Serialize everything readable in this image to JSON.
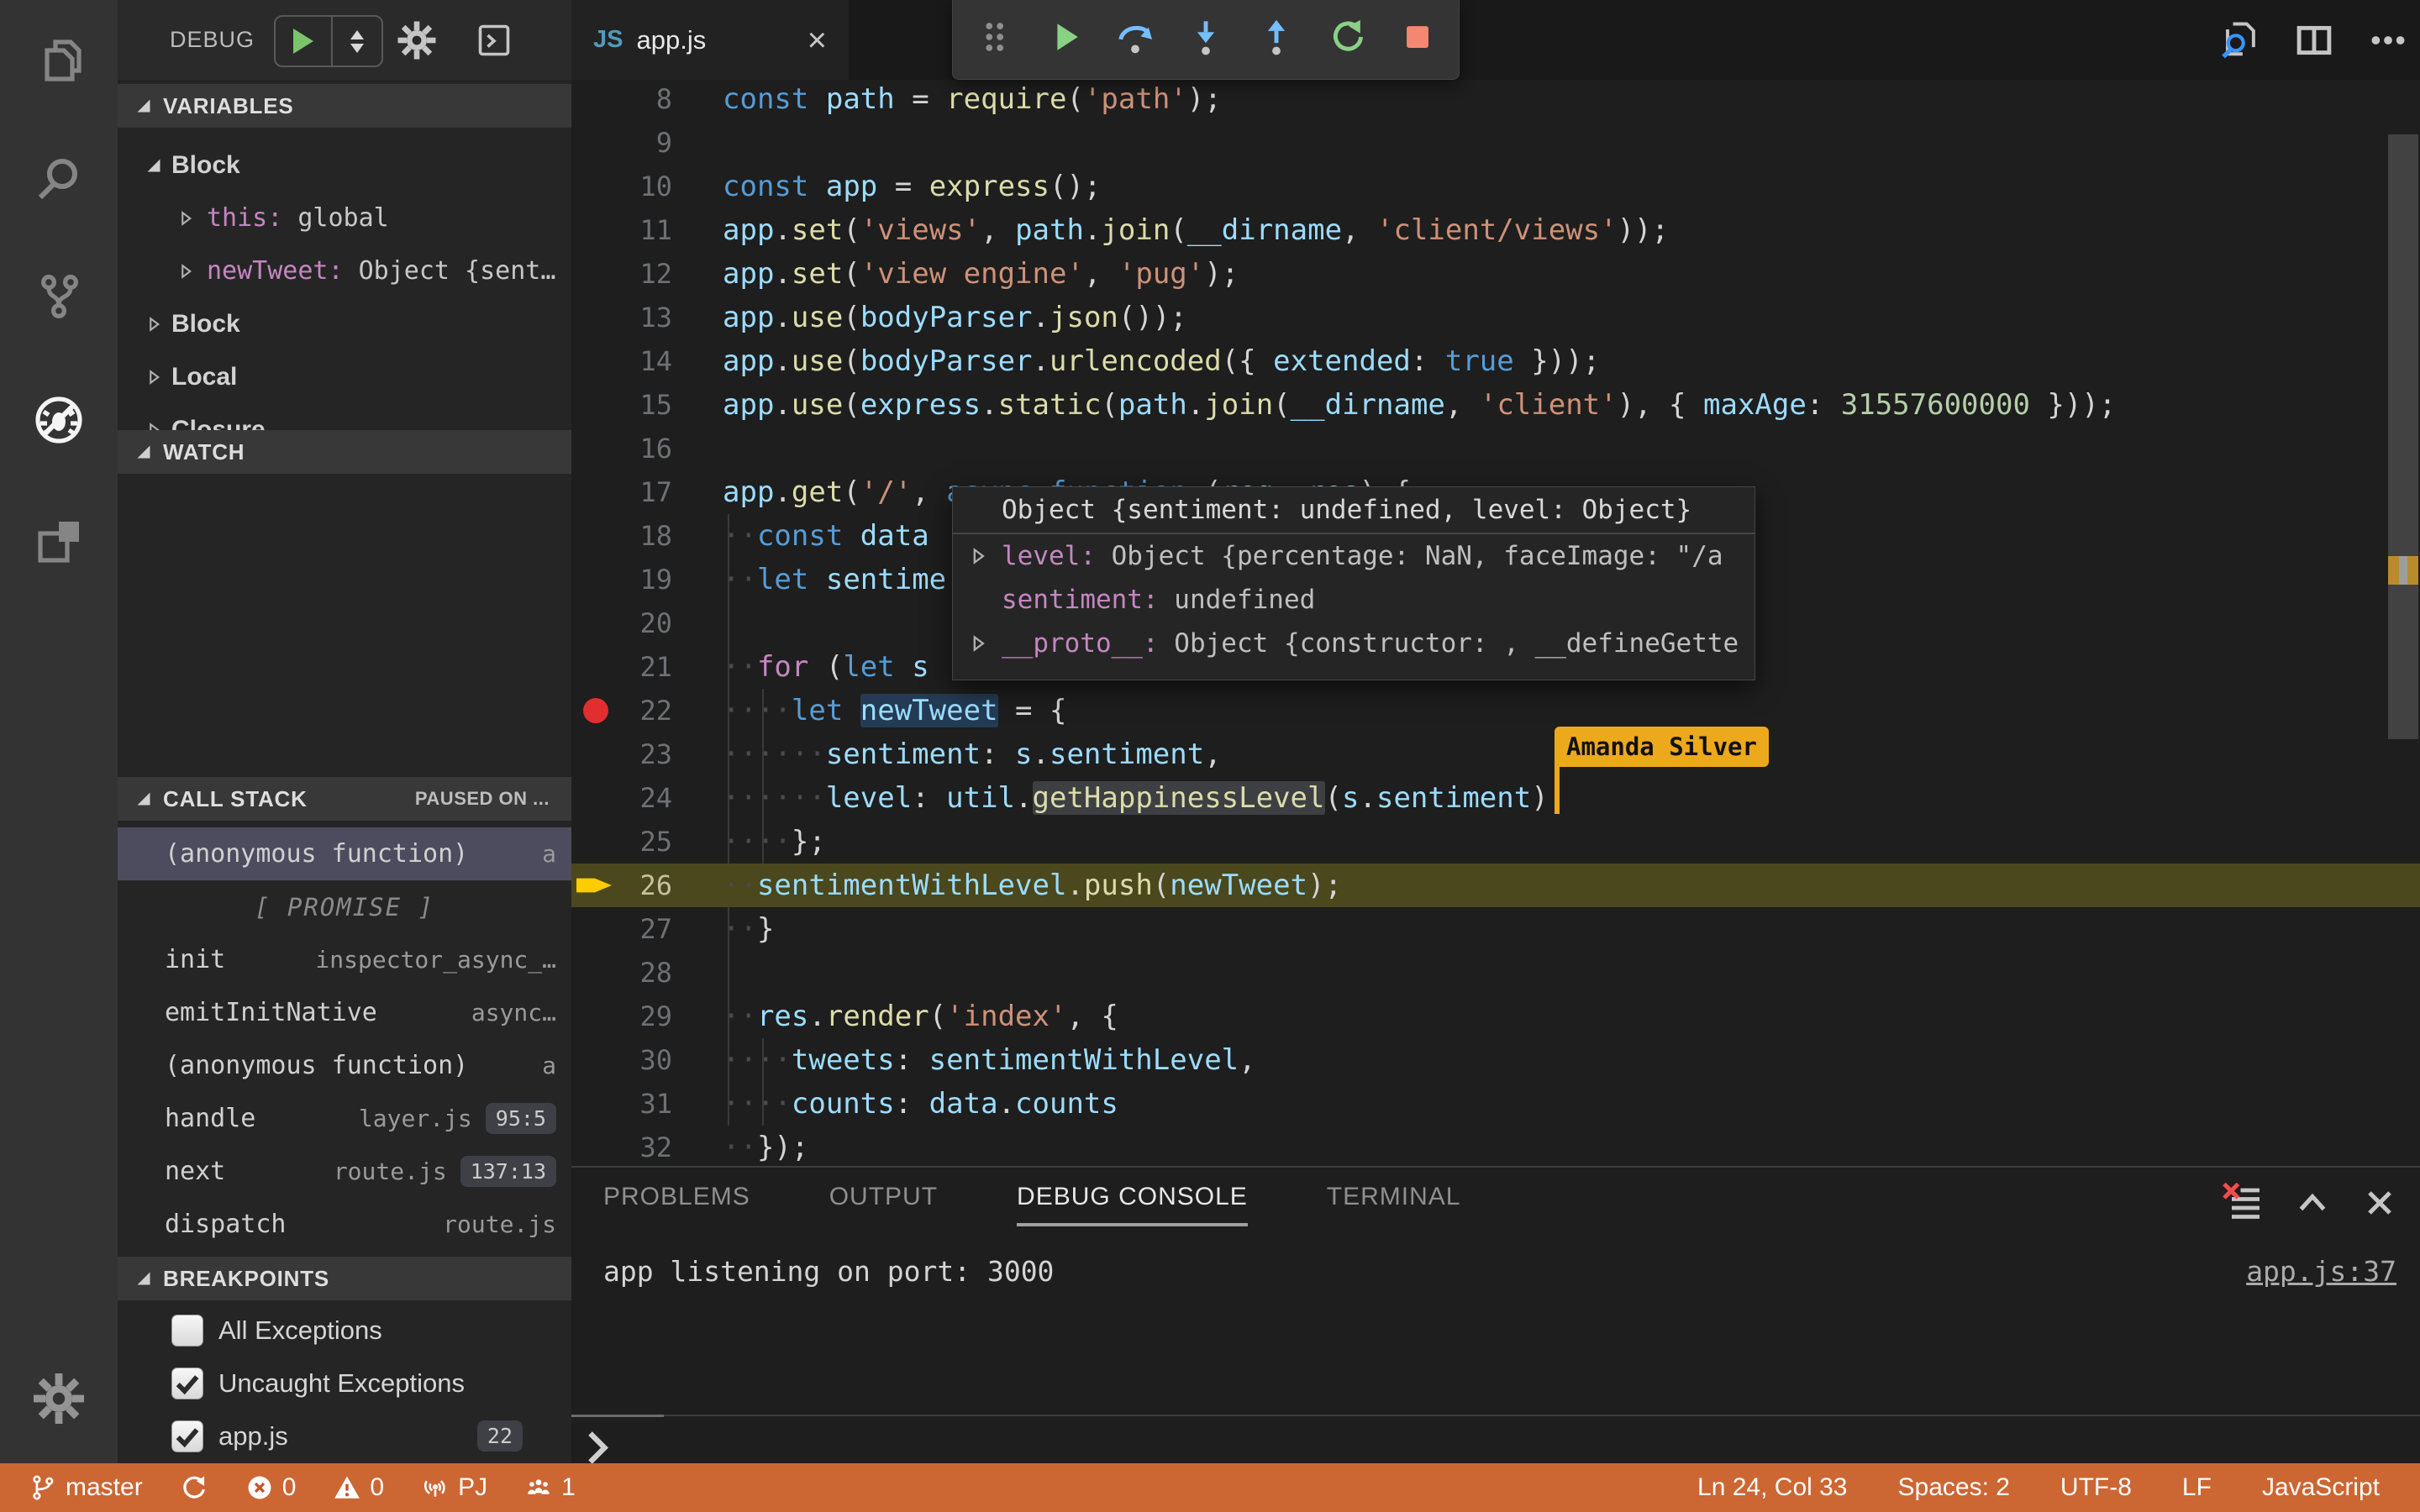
{
  "colors": {
    "status-orange": "#CC6633",
    "breakpoint-red": "#E22E2E",
    "paused-line-olive": "#4A481C",
    "cursor-label-yellow": "#ECA91C",
    "step-blue": "#75BEFF",
    "continue-green": "#89D185",
    "stop-salmon": "#F48771",
    "js-icon-blue": "#519ABA",
    "magnifier-blue": "#3794FF",
    "syntax-keyword": "#569CD6",
    "syntax-control": "#C586C0",
    "syntax-function": "#DCDCAA",
    "syntax-string": "#CE9178",
    "syntax-number": "#B5CEA8",
    "syntax-variable": "#9CDCFE"
  },
  "activity_bar": {
    "items": [
      {
        "icon": "explorer-icon",
        "active": false
      },
      {
        "icon": "search-icon",
        "active": false
      },
      {
        "icon": "source-control-icon",
        "active": false
      },
      {
        "icon": "debug-icon",
        "active": true
      },
      {
        "icon": "extensions-icon",
        "active": false
      }
    ],
    "bottom_items": [
      {
        "icon": "settings-gear-icon"
      }
    ]
  },
  "sidebar": {
    "title": "DEBUG",
    "header_icons": [
      "start-debug-icon",
      "launch-config-selector-icon",
      "configure-gear-icon",
      "debug-console-icon"
    ],
    "variables": {
      "title": "VARIABLES",
      "rows": [
        {
          "type": "group",
          "twisty": "exp",
          "label": "Block"
        },
        {
          "type": "kv",
          "twisty": "col",
          "key": "this: ",
          "value": "global"
        },
        {
          "type": "kv",
          "twisty": "col",
          "key": "newTweet: ",
          "value": "Object {sent…"
        },
        {
          "type": "group",
          "twisty": "col",
          "label": "Block"
        },
        {
          "type": "group",
          "twisty": "col",
          "label": "Local"
        },
        {
          "type": "group",
          "twisty": "col",
          "label": "Closure"
        }
      ]
    },
    "watch": {
      "title": "WATCH"
    },
    "call_stack": {
      "title": "CALL STACK",
      "status": "PAUSED ON ...",
      "frames": [
        {
          "name": "(anonymous function)",
          "file": "a",
          "selected": true
        },
        {
          "separator": "[ PROMISE ]"
        },
        {
          "name": "init",
          "file": "inspector_async_…"
        },
        {
          "name": "emitInitNative",
          "file": "async…"
        },
        {
          "name": "(anonymous function)",
          "file": "a"
        },
        {
          "name": "handle",
          "file": "layer.js",
          "badge": "95:5"
        },
        {
          "name": "next",
          "file": "route.js",
          "badge": "137:13"
        },
        {
          "name": "dispatch",
          "file": "route.js"
        }
      ]
    },
    "breakpoints": {
      "title": "BREAKPOINTS",
      "items": [
        {
          "label": "All Exceptions",
          "checked": false
        },
        {
          "label": "Uncaught Exceptions",
          "checked": true
        },
        {
          "label": "app.js",
          "checked": true,
          "badge": "22"
        }
      ]
    }
  },
  "editor": {
    "tab": {
      "icon": "JS",
      "label": "app.js",
      "close": "×"
    },
    "actions": [
      "open-file-search-icon",
      "split-editor-icon",
      "more-actions-icon"
    ],
    "breakpoint_line": 22,
    "paused_line": 26,
    "live_share": {
      "user": "Amanda Silver"
    },
    "lines": [
      {
        "num": 8,
        "tokens": [
          [
            "k",
            "const"
          ],
          [
            "p",
            " "
          ],
          [
            "v",
            "path"
          ],
          [
            "p",
            " = "
          ],
          [
            "f",
            "require"
          ],
          [
            "p",
            "("
          ],
          [
            "s",
            "'path'"
          ],
          [
            "p",
            ");"
          ]
        ]
      },
      {
        "num": 9,
        "tokens": []
      },
      {
        "num": 10,
        "tokens": [
          [
            "k",
            "const"
          ],
          [
            "p",
            " "
          ],
          [
            "v",
            "app"
          ],
          [
            "p",
            " = "
          ],
          [
            "f",
            "express"
          ],
          [
            "p",
            "();"
          ]
        ]
      },
      {
        "num": 11,
        "tokens": [
          [
            "v",
            "app"
          ],
          [
            "p",
            "."
          ],
          [
            "f",
            "set"
          ],
          [
            "p",
            "("
          ],
          [
            "s",
            "'views'"
          ],
          [
            "p",
            ", "
          ],
          [
            "v",
            "path"
          ],
          [
            "p",
            "."
          ],
          [
            "f",
            "join"
          ],
          [
            "p",
            "("
          ],
          [
            "v",
            "__dirname"
          ],
          [
            "p",
            ", "
          ],
          [
            "s",
            "'client/views'"
          ],
          [
            "p",
            "));"
          ]
        ]
      },
      {
        "num": 12,
        "tokens": [
          [
            "v",
            "app"
          ],
          [
            "p",
            "."
          ],
          [
            "f",
            "set"
          ],
          [
            "p",
            "("
          ],
          [
            "s",
            "'view engine'"
          ],
          [
            "p",
            ", "
          ],
          [
            "s",
            "'pug'"
          ],
          [
            "p",
            ");"
          ]
        ]
      },
      {
        "num": 13,
        "tokens": [
          [
            "v",
            "app"
          ],
          [
            "p",
            "."
          ],
          [
            "f",
            "use"
          ],
          [
            "p",
            "("
          ],
          [
            "v",
            "bodyParser"
          ],
          [
            "p",
            "."
          ],
          [
            "f",
            "json"
          ],
          [
            "p",
            "());"
          ]
        ]
      },
      {
        "num": 14,
        "tokens": [
          [
            "v",
            "app"
          ],
          [
            "p",
            "."
          ],
          [
            "f",
            "use"
          ],
          [
            "p",
            "("
          ],
          [
            "v",
            "bodyParser"
          ],
          [
            "p",
            "."
          ],
          [
            "f",
            "urlencoded"
          ],
          [
            "p",
            "({ "
          ],
          [
            "v",
            "extended"
          ],
          [
            "p",
            ": "
          ],
          [
            "k",
            "true"
          ],
          [
            "p",
            " }));"
          ]
        ]
      },
      {
        "num": 15,
        "tokens": [
          [
            "v",
            "app"
          ],
          [
            "p",
            "."
          ],
          [
            "f",
            "use"
          ],
          [
            "p",
            "("
          ],
          [
            "v",
            "express"
          ],
          [
            "p",
            "."
          ],
          [
            "f",
            "static"
          ],
          [
            "p",
            "("
          ],
          [
            "v",
            "path"
          ],
          [
            "p",
            "."
          ],
          [
            "f",
            "join"
          ],
          [
            "p",
            "("
          ],
          [
            "v",
            "__dirname"
          ],
          [
            "p",
            ", "
          ],
          [
            "s",
            "'client'"
          ],
          [
            "p",
            "), { "
          ],
          [
            "v",
            "maxAge"
          ],
          [
            "p",
            ": "
          ],
          [
            "n",
            "31557600000"
          ],
          [
            "p",
            " }));"
          ]
        ]
      },
      {
        "num": 16,
        "tokens": []
      },
      {
        "num": 17,
        "tokens": [
          [
            "v",
            "app"
          ],
          [
            "p",
            "."
          ],
          [
            "f",
            "get"
          ],
          [
            "p",
            "("
          ],
          [
            "s",
            "'/'"
          ],
          [
            "p",
            ", "
          ],
          [
            "k",
            "async"
          ],
          [
            "p",
            " "
          ],
          [
            "k",
            "function"
          ],
          [
            "p",
            " ("
          ],
          [
            "v",
            "req"
          ],
          [
            "p",
            ", "
          ],
          [
            "v",
            "res"
          ],
          [
            "p",
            ") {"
          ]
        ]
      },
      {
        "num": 18,
        "tokens": [
          [
            "w",
            "··"
          ],
          [
            "k",
            "const"
          ],
          [
            "p",
            " "
          ],
          [
            "v",
            "data"
          ]
        ]
      },
      {
        "num": 19,
        "tokens": [
          [
            "w",
            "··"
          ],
          [
            "k",
            "let"
          ],
          [
            "p",
            " "
          ],
          [
            "v",
            "sentime"
          ]
        ]
      },
      {
        "num": 20,
        "tokens": []
      },
      {
        "num": 21,
        "tokens": [
          [
            "w",
            "··"
          ],
          [
            "c",
            "for"
          ],
          [
            "p",
            " ("
          ],
          [
            "k",
            "let"
          ],
          [
            "p",
            " "
          ],
          [
            "v",
            "s"
          ]
        ]
      },
      {
        "num": 22,
        "tokens": [
          [
            "w",
            "····"
          ],
          [
            "k",
            "let"
          ],
          [
            "p",
            " "
          ],
          [
            "W",
            "newTweet"
          ],
          [
            "p",
            " = {"
          ]
        ]
      },
      {
        "num": 23,
        "tokens": [
          [
            "w",
            "······"
          ],
          [
            "v",
            "sentiment"
          ],
          [
            "p",
            ": "
          ],
          [
            "v",
            "s"
          ],
          [
            "p",
            "."
          ],
          [
            "v",
            "sentiment"
          ],
          [
            "p",
            ","
          ]
        ]
      },
      {
        "num": 24,
        "tokens": [
          [
            "w",
            "······"
          ],
          [
            "v",
            "level"
          ],
          [
            "p",
            ": "
          ],
          [
            "v",
            "util"
          ],
          [
            "p",
            "."
          ],
          [
            "H",
            "getHappinessLevel"
          ],
          [
            "p",
            "("
          ],
          [
            "v",
            "s"
          ],
          [
            "p",
            "."
          ],
          [
            "v",
            "sentiment"
          ],
          [
            "p",
            ")"
          ]
        ]
      },
      {
        "num": 25,
        "tokens": [
          [
            "w",
            "····"
          ],
          [
            "p",
            "};"
          ]
        ]
      },
      {
        "num": 26,
        "tokens": [
          [
            "w",
            "··"
          ],
          [
            "v",
            "sentimentWithLevel"
          ],
          [
            "p",
            "."
          ],
          [
            "f",
            "push"
          ],
          [
            "p",
            "("
          ],
          [
            "v",
            "newTweet"
          ],
          [
            "p",
            ");"
          ]
        ]
      },
      {
        "num": 27,
        "tokens": [
          [
            "w",
            "··"
          ],
          [
            "p",
            "}"
          ]
        ]
      },
      {
        "num": 28,
        "tokens": []
      },
      {
        "num": 29,
        "tokens": [
          [
            "w",
            "··"
          ],
          [
            "v",
            "res"
          ],
          [
            "p",
            "."
          ],
          [
            "f",
            "render"
          ],
          [
            "p",
            "("
          ],
          [
            "s",
            "'index'"
          ],
          [
            "p",
            ", {"
          ]
        ]
      },
      {
        "num": 30,
        "tokens": [
          [
            "w",
            "····"
          ],
          [
            "v",
            "tweets"
          ],
          [
            "p",
            ": "
          ],
          [
            "v",
            "sentimentWithLevel"
          ],
          [
            "p",
            ","
          ]
        ]
      },
      {
        "num": 31,
        "tokens": [
          [
            "w",
            "····"
          ],
          [
            "v",
            "counts"
          ],
          [
            "p",
            ": "
          ],
          [
            "v",
            "data"
          ],
          [
            "p",
            "."
          ],
          [
            "v",
            "counts"
          ]
        ]
      },
      {
        "num": 32,
        "tokens": [
          [
            "w",
            "··"
          ],
          [
            "p",
            "});"
          ]
        ]
      }
    ]
  },
  "debug_toolbar": {
    "buttons": [
      {
        "icon": "gripper-icon"
      },
      {
        "icon": "continue-icon"
      },
      {
        "icon": "step-over-icon"
      },
      {
        "icon": "step-into-icon"
      },
      {
        "icon": "step-out-icon"
      },
      {
        "icon": "restart-icon"
      },
      {
        "icon": "stop-icon"
      }
    ]
  },
  "hover_tooltip": {
    "title": "Object {sentiment: undefined, level: Object}",
    "rows": [
      {
        "expandable": true,
        "key": "level:",
        "value": " Object {percentage: NaN, faceImage: \"/a"
      },
      {
        "expandable": false,
        "key": "sentiment:",
        "value": " undefined"
      },
      {
        "expandable": true,
        "key": "__proto__:",
        "value": " Object {constructor: , __defineGette"
      }
    ]
  },
  "panel": {
    "tabs": [
      {
        "label": "PROBLEMS",
        "active": false
      },
      {
        "label": "OUTPUT",
        "active": false
      },
      {
        "label": "DEBUG CONSOLE",
        "active": true
      },
      {
        "label": "TERMINAL",
        "active": false
      }
    ],
    "actions": [
      "clear-console-icon",
      "maximize-panel-icon",
      "close-panel-icon"
    ],
    "console_line": "app listening on port: 3000",
    "source_link": "app.js:37"
  },
  "status_bar": {
    "left": [
      {
        "icon": "git-branch-icon",
        "label": "master"
      },
      {
        "icon": "sync-icon",
        "label": ""
      },
      {
        "icon": "error-circle-icon",
        "label": "0"
      },
      {
        "icon": "warning-triangle-icon",
        "label": "0"
      },
      {
        "icon": "live-share-icon",
        "label": "PJ"
      },
      {
        "icon": "people-icon",
        "label": "1"
      }
    ],
    "right": [
      {
        "label": "Ln 24, Col 33"
      },
      {
        "label": "Spaces: 2"
      },
      {
        "label": "UTF-8"
      },
      {
        "label": "LF"
      },
      {
        "label": "JavaScript"
      }
    ]
  }
}
